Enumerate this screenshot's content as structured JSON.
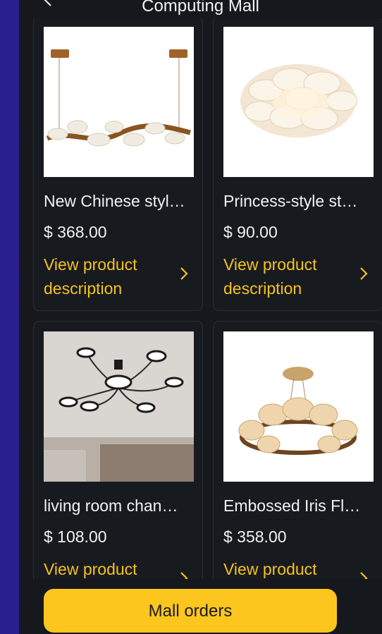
{
  "header": {
    "title": "Computing Mall"
  },
  "products": [
    {
      "name": "New Chinese styl…",
      "price": "$ 368.00",
      "link_label": "View product description",
      "image": "chinese-style-ceiling-light"
    },
    {
      "name": "Princess-style st…",
      "price": "$ 90.00",
      "link_label": "View product description",
      "image": "petal-ceiling-lamp"
    },
    {
      "name": "living room chan…",
      "price": "$ 108.00",
      "link_label": "View product description",
      "image": "living-room-chandelier"
    },
    {
      "name": "Embossed Iris Fl…",
      "price": "$ 358.00",
      "link_label": "View product description",
      "image": "iris-flower-chandelier"
    }
  ],
  "footer": {
    "button_label": "Mall orders"
  },
  "colors": {
    "background": "#15181d",
    "accent": "#fcc61f",
    "link": "#f6c21c",
    "outer": "#2a1f8f"
  }
}
